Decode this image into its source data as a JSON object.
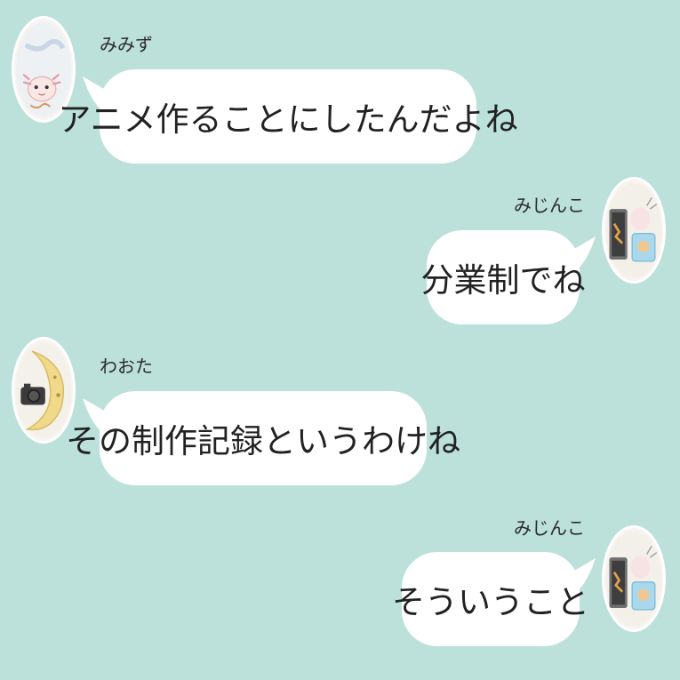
{
  "messages": [
    {
      "sender": "みみず",
      "text": "アニメ作ることにしたんだよね",
      "side": "left",
      "avatar": "axolotl-avatar"
    },
    {
      "sender": "みじんこ",
      "text": "分業制でね",
      "side": "right",
      "avatar": "drawing-tablet-avatar"
    },
    {
      "sender": "わおた",
      "text": "その制作記録というわけね",
      "side": "left",
      "avatar": "moon-camera-avatar"
    },
    {
      "sender": "みじんこ",
      "text": "そういうこと",
      "side": "right",
      "avatar": "drawing-tablet-avatar"
    }
  ],
  "colors": {
    "background": "#bce0da",
    "bubble": "#ffffff",
    "text": "#222222"
  }
}
